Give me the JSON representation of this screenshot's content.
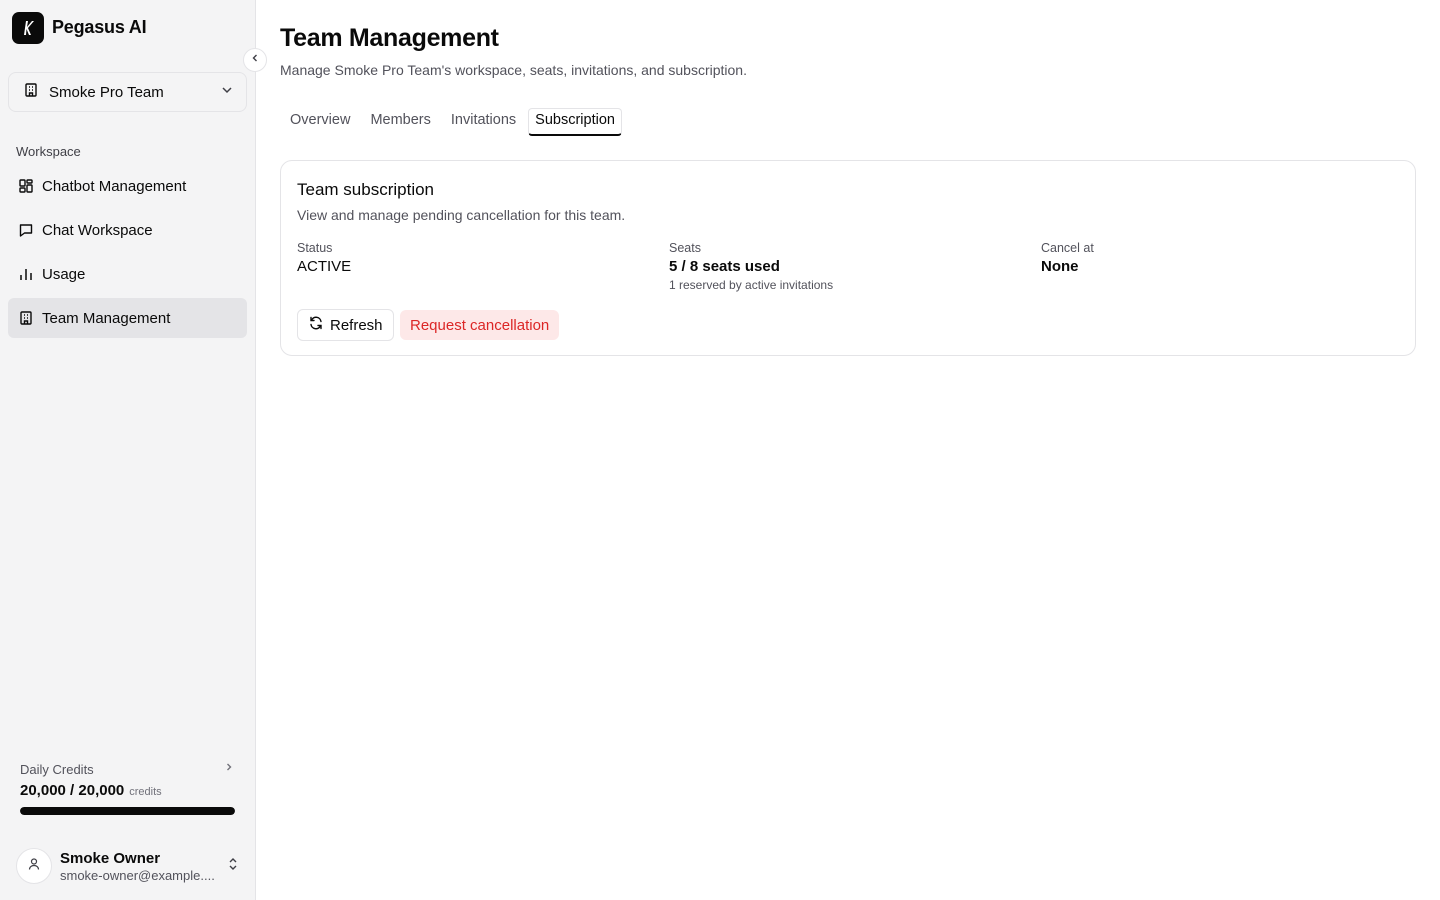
{
  "app": {
    "name": "Pegasus AI"
  },
  "team_selector": {
    "label": "Smoke Pro Team"
  },
  "sidebar": {
    "section_label": "Workspace",
    "items": [
      {
        "label": "Chatbot Management",
        "icon": "layout-dashboard-icon"
      },
      {
        "label": "Chat Workspace",
        "icon": "message-square-icon"
      },
      {
        "label": "Usage",
        "icon": "bar-chart-icon"
      },
      {
        "label": "Team Management",
        "icon": "building-icon",
        "active": true
      }
    ]
  },
  "credits": {
    "title": "Daily Credits",
    "value": "20,000 / 20,000",
    "unit": "credits",
    "used_fraction": 1.0
  },
  "user": {
    "name": "Smoke Owner",
    "email": "smoke-owner@example...."
  },
  "page": {
    "title": "Team Management",
    "subtitle": "Manage Smoke Pro Team's workspace, seats, invitations, and subscription."
  },
  "tabs": [
    {
      "label": "Overview"
    },
    {
      "label": "Members"
    },
    {
      "label": "Invitations"
    },
    {
      "label": "Subscription",
      "active": true
    }
  ],
  "subscription": {
    "title": "Team subscription",
    "description": "View and manage pending cancellation for this team.",
    "status_label": "Status",
    "status_value": "ACTIVE",
    "seats_label": "Seats",
    "seats_value": "5 / 8 seats used",
    "seats_note": "1 reserved by active invitations",
    "cancel_label": "Cancel at",
    "cancel_value": "None",
    "refresh_label": "Refresh",
    "request_cancel_label": "Request cancellation"
  },
  "colors": {
    "accent": "#0a0a0a",
    "danger": "#dc2626",
    "danger_bg": "#fde8e8",
    "sidebar_bg": "#f4f4f5"
  }
}
